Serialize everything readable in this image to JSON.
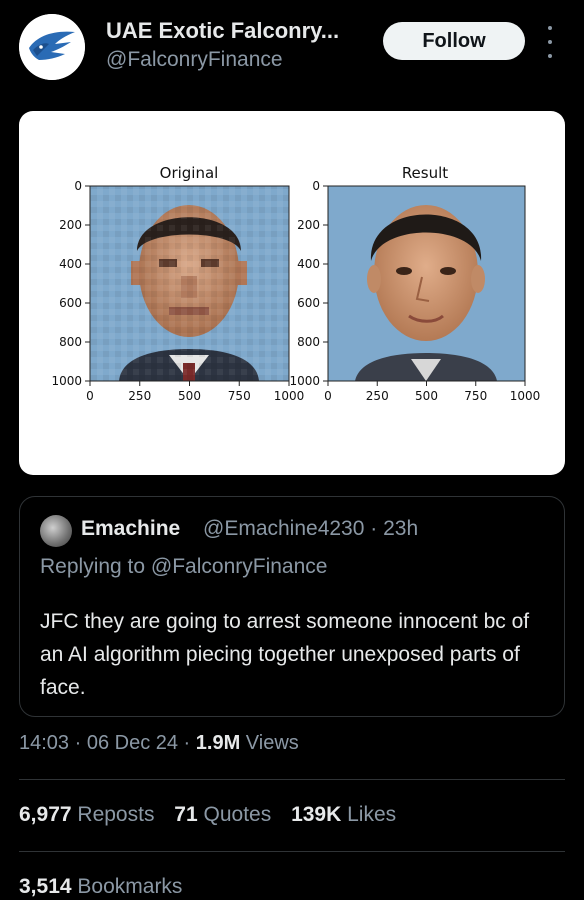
{
  "account": {
    "name": "UAE Exotic Falconry...",
    "handle": "@FalconryFinance",
    "follow_label": "Follow",
    "avatar_icon": "falcon-logo-icon",
    "more_icon": "more-vertical-icon"
  },
  "media": {
    "panels": [
      {
        "title": "Original",
        "y_ticks": [
          "0",
          "200",
          "400",
          "600",
          "800",
          "1000"
        ],
        "x_ticks": [
          "0",
          "250",
          "500",
          "750",
          "1000"
        ]
      },
      {
        "title": "Result",
        "y_ticks": [
          "0",
          "200",
          "400",
          "600",
          "800",
          "1000"
        ],
        "x_ticks": [
          "0",
          "250",
          "500",
          "750",
          "1000"
        ]
      }
    ]
  },
  "quote": {
    "name": "Emachine",
    "handle": "@Emachine4230",
    "time": "23h",
    "meta": "@Emachine4230 · 23h",
    "replying": "Replying to @FalconryFinance",
    "text": "JFC they are going to arrest someone innocent bc of an AI algorithm piecing together unexposed parts of face."
  },
  "post": {
    "time": "14:03",
    "date": "06 Dec 24",
    "time_date": "14:03 · 06 Dec 24 · ",
    "views_count": "1.9M",
    "views_label": " Views"
  },
  "stats": {
    "reposts": {
      "count": "6,977",
      "label": "Reposts"
    },
    "quotes": {
      "count": "71",
      "label": "Quotes"
    },
    "likes": {
      "count": "139K",
      "label": "Likes"
    },
    "bookmarks": {
      "count": "3,514",
      "label": "Bookmarks"
    }
  },
  "colors": {
    "background": "#000000",
    "text": "#e7e9ea",
    "muted": "#8b98a5",
    "border": "#2f3336",
    "follow_bg": "#eff3f4"
  }
}
